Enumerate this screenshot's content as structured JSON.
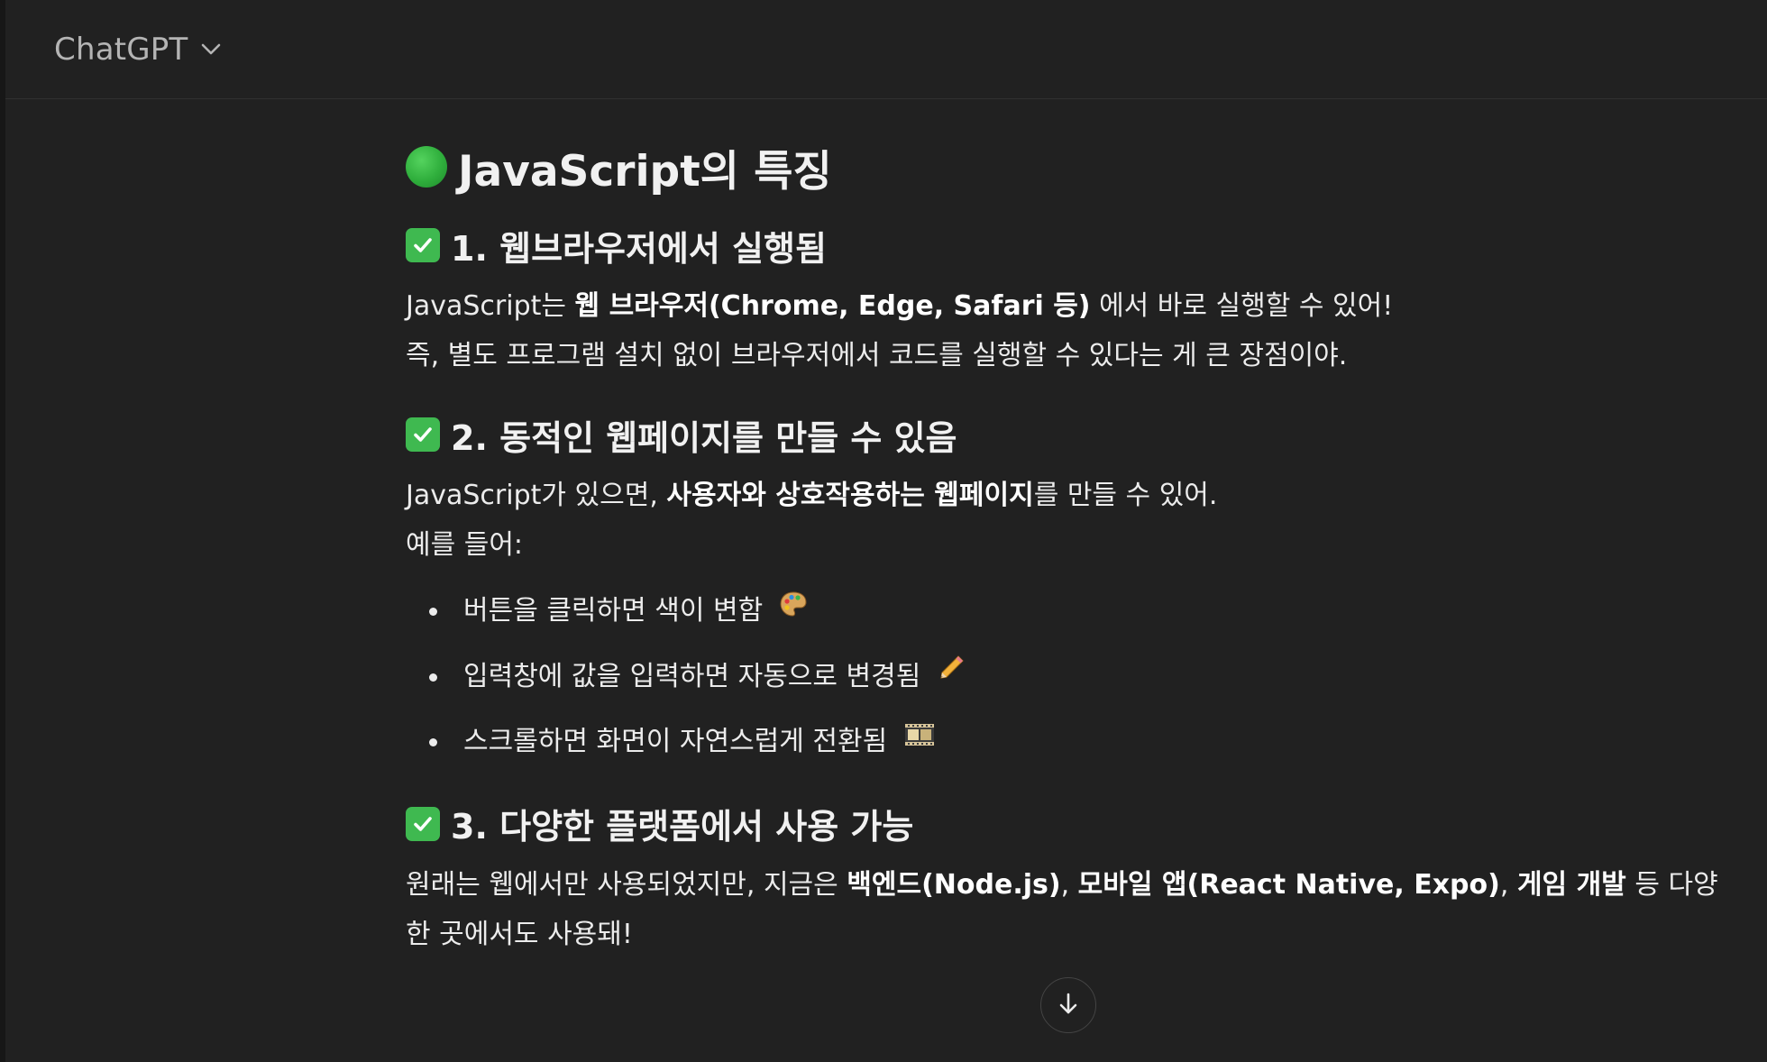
{
  "header": {
    "model_name": "ChatGPT"
  },
  "message": {
    "title": "JavaScript의 특징",
    "sections": [
      {
        "heading": "1. 웹브라우저에서 실행됨",
        "line1_pre": "JavaScript는 ",
        "line1_bold": "웹 브라우저(Chrome, Edge, Safari 등)",
        "line1_post": " 에서 바로 실행할 수 있어!",
        "line2": "즉, 별도 프로그램 설치 없이 브라우저에서 코드를 실행할 수 있다는 게 큰 장점이야."
      },
      {
        "heading": "2. 동적인 웹페이지를 만들 수 있음",
        "line1_pre": "JavaScript가 있으면, ",
        "line1_bold": "사용자와 상호작용하는 웹페이지",
        "line1_post": "를 만들 수 있어.",
        "line2": "예를 들어:",
        "bullets": [
          "버튼을 클릭하면 색이 변함",
          "입력창에 값을 입력하면 자동으로 변경됨",
          "스크롤하면 화면이 자연스럽게 전환됨"
        ]
      },
      {
        "heading": "3. 다양한 플랫폼에서 사용 가능",
        "p_a": "원래는 웹에서만 사용되었지만, 지금은 ",
        "p_b": "백엔드(Node.js)",
        "p_c": ", ",
        "p_d": "모바일 앱(React Native, Expo)",
        "p_e": ", ",
        "p_f": "게임 개발",
        "p_g": " 등 다양한 곳에서도 사용돼!"
      }
    ]
  },
  "icons": {
    "title_icon": "green-circle-icon",
    "heading_icon": "check-mark-button-icon",
    "bullet_icons": [
      "artist-palette-icon",
      "pencil-icon",
      "film-frames-icon"
    ],
    "scroll_icon": "arrow-down-icon"
  },
  "colors": {
    "background": "#212121",
    "text": "#ececec",
    "check_green": "#3fb950",
    "circle_green": "#2fae3c"
  }
}
